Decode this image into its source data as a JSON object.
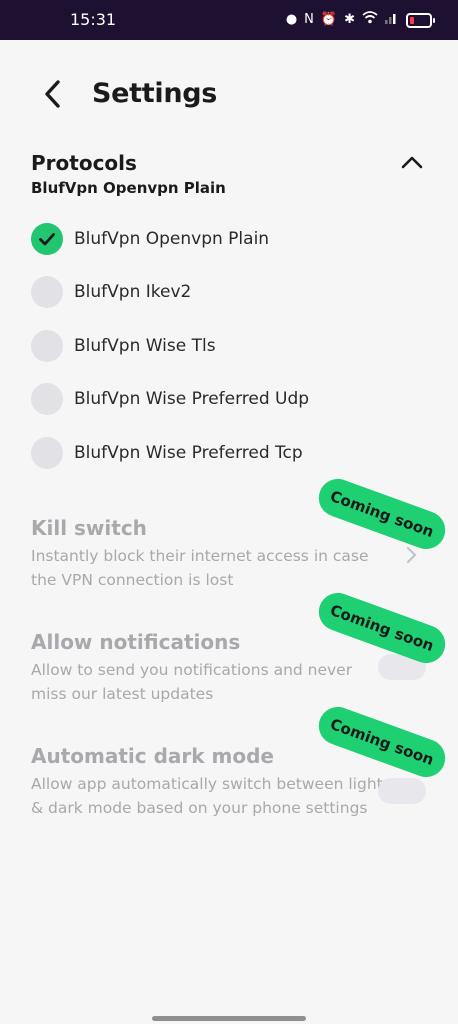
{
  "status_bar": {
    "time": "15:31",
    "icons": [
      "spy-icon",
      "nfc-icon",
      "alarm-icon",
      "bluetooth-icon",
      "wifi-icon",
      "signal-icon",
      "battery-icon"
    ]
  },
  "header": {
    "title": "Settings",
    "back_icon": "chevron-left-icon"
  },
  "protocols": {
    "title": "Protocols",
    "selected": "BlufVpn Openvpn Plain",
    "collapse_icon": "chevron-up-icon",
    "items": [
      {
        "label": "BlufVpn Openvpn Plain",
        "checked": true
      },
      {
        "label": "BlufVpn Ikev2",
        "checked": false
      },
      {
        "label": "BlufVpn Wise Tls",
        "checked": false
      },
      {
        "label": "BlufVpn Wise Preferred Udp",
        "checked": false
      },
      {
        "label": "BlufVpn Wise Preferred Tcp",
        "checked": false
      }
    ]
  },
  "features": [
    {
      "title": "Kill switch",
      "description": "Instantly block their internet access in case the VPN connection is lost",
      "badge": "Coming soon",
      "control": "chevron-right-icon"
    },
    {
      "title": "Allow notifications",
      "description": "Allow to send you notifications and never miss our latest updates",
      "badge": "Coming soon",
      "control": "toggle",
      "enabled": false
    },
    {
      "title": "Automatic dark mode",
      "description": "Allow app automatically switch between light & dark mode based on your phone settings",
      "badge": "Coming soon",
      "control": "toggle",
      "enabled": false
    }
  ],
  "colors": {
    "accent": "#22c570",
    "status_bar": "#1e1030",
    "disabled_text": "#a8a8ad"
  }
}
